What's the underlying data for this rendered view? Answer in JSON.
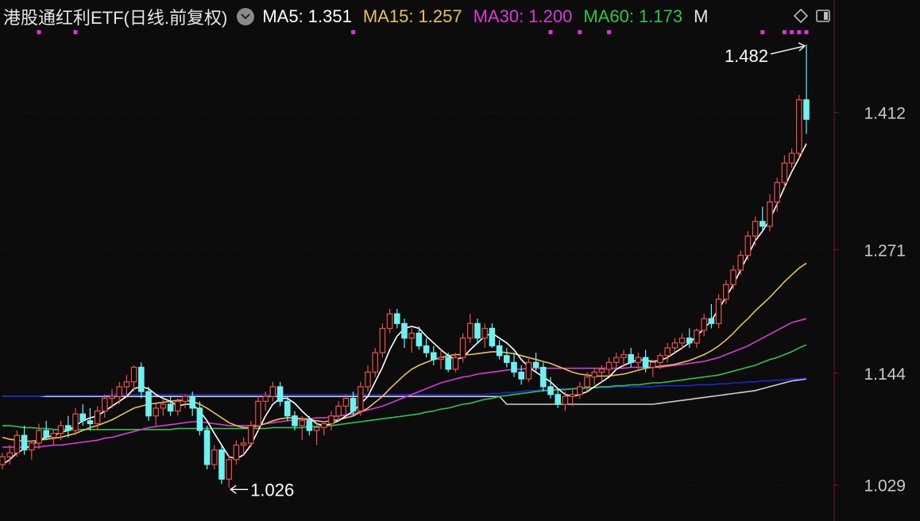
{
  "header": {
    "title": "港股通红利ETF(日线.前复权)",
    "ma_labels": [
      {
        "label": "MA5: 1.351",
        "color": "#ffffff"
      },
      {
        "label": "MA15: 1.257",
        "color": "#e8c15a"
      },
      {
        "label": "MA30: 1.200",
        "color": "#d83ad8"
      },
      {
        "label": "MA60: 1.173",
        "color": "#2ec44a"
      },
      {
        "label": "M",
        "color": "#e6e6e6"
      }
    ]
  },
  "colors": {
    "up": "#e8504a",
    "down": "#6ef1f1",
    "grid": "#4a1010",
    "bg": "#0c0c0c",
    "axis": "#7a1a1a",
    "ma120": "#1a26d8",
    "ma250": "#cfcfcf"
  },
  "chart_data": {
    "type": "candlestick",
    "y_ticks": [
      "1.412",
      "1.271",
      "1.144",
      "1.029"
    ],
    "annotations": {
      "high": "1.482",
      "low": "1.026"
    },
    "ohlc": [
      [
        1.05,
        1.062,
        1.045,
        1.058
      ],
      [
        1.058,
        1.07,
        1.05,
        1.062
      ],
      [
        1.062,
        1.085,
        1.058,
        1.08
      ],
      [
        1.08,
        1.09,
        1.06,
        1.065
      ],
      [
        1.065,
        1.075,
        1.055,
        1.072
      ],
      [
        1.072,
        1.092,
        1.066,
        1.085
      ],
      [
        1.085,
        1.095,
        1.075,
        1.078
      ],
      [
        1.078,
        1.085,
        1.07,
        1.082
      ],
      [
        1.082,
        1.095,
        1.075,
        1.09
      ],
      [
        1.09,
        1.1,
        1.078,
        1.085
      ],
      [
        1.085,
        1.108,
        1.08,
        1.102
      ],
      [
        1.102,
        1.112,
        1.09,
        1.095
      ],
      [
        1.095,
        1.108,
        1.085,
        1.092
      ],
      [
        1.092,
        1.11,
        1.085,
        1.105
      ],
      [
        1.105,
        1.122,
        1.098,
        1.118
      ],
      [
        1.118,
        1.128,
        1.108,
        1.12
      ],
      [
        1.12,
        1.135,
        1.112,
        1.13
      ],
      [
        1.13,
        1.142,
        1.12,
        1.135
      ],
      [
        1.135,
        1.152,
        1.125,
        1.15
      ],
      [
        1.15,
        1.155,
        1.118,
        1.125
      ],
      [
        1.125,
        1.13,
        1.095,
        1.1
      ],
      [
        1.1,
        1.112,
        1.09,
        1.108
      ],
      [
        1.108,
        1.118,
        1.1,
        1.112
      ],
      [
        1.112,
        1.12,
        1.1,
        1.105
      ],
      [
        1.105,
        1.118,
        1.1,
        1.115
      ],
      [
        1.115,
        1.122,
        1.108,
        1.12
      ],
      [
        1.12,
        1.125,
        1.1,
        1.108
      ],
      [
        1.108,
        1.115,
        1.08,
        1.085
      ],
      [
        1.085,
        1.09,
        1.045,
        1.05
      ],
      [
        1.05,
        1.07,
        1.045,
        1.065
      ],
      [
        1.065,
        1.07,
        1.03,
        1.035
      ],
      [
        1.035,
        1.06,
        1.026,
        1.055
      ],
      [
        1.055,
        1.075,
        1.05,
        1.07
      ],
      [
        1.07,
        1.078,
        1.06,
        1.072
      ],
      [
        1.072,
        1.095,
        1.068,
        1.09
      ],
      [
        1.09,
        1.12,
        1.085,
        1.115
      ],
      [
        1.115,
        1.125,
        1.105,
        1.12
      ],
      [
        1.12,
        1.135,
        1.115,
        1.13
      ],
      [
        1.13,
        1.135,
        1.11,
        1.115
      ],
      [
        1.115,
        1.12,
        1.095,
        1.1
      ],
      [
        1.1,
        1.105,
        1.085,
        1.09
      ],
      [
        1.09,
        1.1,
        1.075,
        1.095
      ],
      [
        1.095,
        1.1,
        1.08,
        1.085
      ],
      [
        1.085,
        1.092,
        1.07,
        1.088
      ],
      [
        1.088,
        1.095,
        1.08,
        1.092
      ],
      [
        1.092,
        1.105,
        1.085,
        1.1
      ],
      [
        1.1,
        1.115,
        1.095,
        1.11
      ],
      [
        1.11,
        1.122,
        1.102,
        1.118
      ],
      [
        1.118,
        1.125,
        1.1,
        1.105
      ],
      [
        1.105,
        1.135,
        1.1,
        1.13
      ],
      [
        1.13,
        1.152,
        1.125,
        1.145
      ],
      [
        1.145,
        1.17,
        1.14,
        1.165
      ],
      [
        1.165,
        1.195,
        1.16,
        1.19
      ],
      [
        1.19,
        1.21,
        1.185,
        1.205
      ],
      [
        1.205,
        1.21,
        1.19,
        1.195
      ],
      [
        1.195,
        1.2,
        1.17,
        1.18
      ],
      [
        1.18,
        1.19,
        1.165,
        1.185
      ],
      [
        1.185,
        1.192,
        1.168,
        1.172
      ],
      [
        1.172,
        1.18,
        1.16,
        1.165
      ],
      [
        1.165,
        1.172,
        1.152,
        1.158
      ],
      [
        1.158,
        1.168,
        1.148,
        1.16
      ],
      [
        1.16,
        1.165,
        1.145,
        1.148
      ],
      [
        1.148,
        1.165,
        1.145,
        1.16
      ],
      [
        1.16,
        1.185,
        1.155,
        1.18
      ],
      [
        1.18,
        1.205,
        1.175,
        1.195
      ],
      [
        1.195,
        1.2,
        1.175,
        1.18
      ],
      [
        1.18,
        1.195,
        1.17,
        1.19
      ],
      [
        1.19,
        1.195,
        1.17,
        1.172
      ],
      [
        1.172,
        1.178,
        1.158,
        1.162
      ],
      [
        1.162,
        1.17,
        1.15,
        1.155
      ],
      [
        1.155,
        1.165,
        1.14,
        1.145
      ],
      [
        1.145,
        1.152,
        1.132,
        1.138
      ],
      [
        1.138,
        1.16,
        1.135,
        1.155
      ],
      [
        1.155,
        1.165,
        1.145,
        1.15
      ],
      [
        1.15,
        1.155,
        1.125,
        1.13
      ],
      [
        1.13,
        1.14,
        1.118,
        1.122
      ],
      [
        1.122,
        1.128,
        1.108,
        1.112
      ],
      [
        1.112,
        1.125,
        1.105,
        1.12
      ],
      [
        1.12,
        1.128,
        1.11,
        1.122
      ],
      [
        1.122,
        1.135,
        1.118,
        1.13
      ],
      [
        1.13,
        1.145,
        1.125,
        1.14
      ],
      [
        1.14,
        1.15,
        1.132,
        1.145
      ],
      [
        1.145,
        1.152,
        1.135,
        1.148
      ],
      [
        1.148,
        1.16,
        1.142,
        1.155
      ],
      [
        1.155,
        1.165,
        1.148,
        1.16
      ],
      [
        1.16,
        1.168,
        1.15,
        1.163
      ],
      [
        1.163,
        1.17,
        1.15,
        1.155
      ],
      [
        1.155,
        1.165,
        1.148,
        1.16
      ],
      [
        1.16,
        1.168,
        1.145,
        1.15
      ],
      [
        1.15,
        1.158,
        1.14,
        1.155
      ],
      [
        1.155,
        1.165,
        1.148,
        1.162
      ],
      [
        1.162,
        1.175,
        1.155,
        1.17
      ],
      [
        1.17,
        1.18,
        1.165,
        1.175
      ],
      [
        1.175,
        1.185,
        1.168,
        1.18
      ],
      [
        1.18,
        1.19,
        1.17,
        1.175
      ],
      [
        1.175,
        1.19,
        1.17,
        1.188
      ],
      [
        1.188,
        1.205,
        1.182,
        1.2
      ],
      [
        1.2,
        1.215,
        1.19,
        1.195
      ],
      [
        1.195,
        1.225,
        1.19,
        1.22
      ],
      [
        1.22,
        1.24,
        1.215,
        1.235
      ],
      [
        1.235,
        1.255,
        1.23,
        1.25
      ],
      [
        1.25,
        1.27,
        1.245,
        1.265
      ],
      [
        1.265,
        1.29,
        1.26,
        1.285
      ],
      [
        1.285,
        1.305,
        1.275,
        1.3
      ],
      [
        1.3,
        1.315,
        1.29,
        1.295
      ],
      [
        1.295,
        1.328,
        1.29,
        1.32
      ],
      [
        1.32,
        1.345,
        1.31,
        1.34
      ],
      [
        1.34,
        1.368,
        1.335,
        1.36
      ],
      [
        1.36,
        1.375,
        1.355,
        1.37
      ],
      [
        1.37,
        1.43,
        1.365,
        1.425
      ],
      [
        1.425,
        1.482,
        1.39,
        1.405
      ]
    ],
    "ma5": [
      1.05,
      1.055,
      1.062,
      1.066,
      1.07,
      1.075,
      1.078,
      1.08,
      1.083,
      1.085,
      1.09,
      1.095,
      1.098,
      1.1,
      1.105,
      1.11,
      1.115,
      1.12,
      1.128,
      1.13,
      1.128,
      1.122,
      1.118,
      1.115,
      1.11,
      1.112,
      1.112,
      1.105,
      1.095,
      1.082,
      1.07,
      1.058,
      1.056,
      1.06,
      1.07,
      1.085,
      1.1,
      1.112,
      1.118,
      1.118,
      1.113,
      1.105,
      1.098,
      1.092,
      1.09,
      1.092,
      1.095,
      1.1,
      1.105,
      1.112,
      1.12,
      1.135,
      1.15,
      1.168,
      1.182,
      1.19,
      1.192,
      1.19,
      1.182,
      1.175,
      1.168,
      1.162,
      1.158,
      1.16,
      1.168,
      1.175,
      1.182,
      1.185,
      1.18,
      1.175,
      1.168,
      1.158,
      1.15,
      1.145,
      1.14,
      1.135,
      1.128,
      1.122,
      1.12,
      1.122,
      1.125,
      1.13,
      1.135,
      1.14,
      1.148,
      1.152,
      1.155,
      1.158,
      1.157,
      1.156,
      1.157,
      1.16,
      1.165,
      1.17,
      1.175,
      1.182,
      1.19,
      1.198,
      1.21,
      1.222,
      1.235,
      1.25,
      1.265,
      1.28,
      1.29,
      1.302,
      1.318,
      1.335,
      1.351,
      1.365,
      1.38
    ],
    "ma15": [
      1.078,
      1.076,
      1.075,
      1.074,
      1.074,
      1.075,
      1.076,
      1.077,
      1.078,
      1.08,
      1.082,
      1.085,
      1.088,
      1.09,
      1.093,
      1.096,
      1.1,
      1.104,
      1.108,
      1.11,
      1.112,
      1.113,
      1.114,
      1.115,
      1.116,
      1.116,
      1.115,
      1.112,
      1.108,
      1.103,
      1.098,
      1.093,
      1.09,
      1.088,
      1.088,
      1.09,
      1.092,
      1.095,
      1.097,
      1.098,
      1.098,
      1.097,
      1.096,
      1.095,
      1.094,
      1.095,
      1.096,
      1.098,
      1.1,
      1.104,
      1.108,
      1.114,
      1.12,
      1.128,
      1.135,
      1.142,
      1.148,
      1.152,
      1.155,
      1.158,
      1.16,
      1.162,
      1.163,
      1.163,
      1.163,
      1.164,
      1.165,
      1.166,
      1.166,
      1.165,
      1.164,
      1.162,
      1.16,
      1.158,
      1.156,
      1.154,
      1.151,
      1.148,
      1.145,
      1.143,
      1.142,
      1.141,
      1.141,
      1.141,
      1.142,
      1.143,
      1.145,
      1.147,
      1.149,
      1.15,
      1.151,
      1.152,
      1.153,
      1.155,
      1.157,
      1.16,
      1.163,
      1.167,
      1.172,
      1.178,
      1.185,
      1.193,
      1.2,
      1.208,
      1.215,
      1.222,
      1.23,
      1.238,
      1.245,
      1.252,
      1.257
    ],
    "ma30": [
      1.068,
      1.068,
      1.068,
      1.068,
      1.068,
      1.068,
      1.069,
      1.07,
      1.07,
      1.071,
      1.072,
      1.073,
      1.074,
      1.075,
      1.077,
      1.078,
      1.08,
      1.082,
      1.084,
      1.086,
      1.088,
      1.089,
      1.09,
      1.091,
      1.092,
      1.093,
      1.094,
      1.094,
      1.093,
      1.092,
      1.091,
      1.09,
      1.09,
      1.09,
      1.09,
      1.091,
      1.092,
      1.093,
      1.094,
      1.095,
      1.096,
      1.097,
      1.097,
      1.098,
      1.098,
      1.099,
      1.1,
      1.101,
      1.102,
      1.104,
      1.106,
      1.108,
      1.11,
      1.113,
      1.116,
      1.119,
      1.122,
      1.125,
      1.128,
      1.131,
      1.134,
      1.136,
      1.138,
      1.14,
      1.141,
      1.143,
      1.144,
      1.145,
      1.146,
      1.147,
      1.148,
      1.148,
      1.149,
      1.149,
      1.149,
      1.149,
      1.149,
      1.149,
      1.149,
      1.149,
      1.149,
      1.149,
      1.149,
      1.149,
      1.149,
      1.149,
      1.15,
      1.15,
      1.15,
      1.15,
      1.15,
      1.151,
      1.152,
      1.153,
      1.154,
      1.155,
      1.156,
      1.158,
      1.16,
      1.163,
      1.166,
      1.169,
      1.172,
      1.176,
      1.18,
      1.184,
      1.188,
      1.192,
      1.196,
      1.198,
      1.2
    ],
    "ma60": [
      1.09,
      1.09,
      1.089,
      1.088,
      1.088,
      1.087,
      1.087,
      1.086,
      1.086,
      1.086,
      1.086,
      1.086,
      1.086,
      1.086,
      1.086,
      1.086,
      1.086,
      1.086,
      1.086,
      1.086,
      1.086,
      1.086,
      1.086,
      1.086,
      1.087,
      1.087,
      1.087,
      1.087,
      1.087,
      1.087,
      1.087,
      1.087,
      1.087,
      1.087,
      1.087,
      1.087,
      1.087,
      1.088,
      1.088,
      1.088,
      1.088,
      1.088,
      1.089,
      1.089,
      1.09,
      1.09,
      1.091,
      1.092,
      1.093,
      1.094,
      1.095,
      1.096,
      1.097,
      1.098,
      1.099,
      1.1,
      1.101,
      1.102,
      1.104,
      1.105,
      1.107,
      1.108,
      1.11,
      1.112,
      1.113,
      1.115,
      1.117,
      1.118,
      1.12,
      1.121,
      1.122,
      1.123,
      1.124,
      1.125,
      1.126,
      1.126,
      1.127,
      1.127,
      1.128,
      1.128,
      1.129,
      1.129,
      1.13,
      1.13,
      1.131,
      1.131,
      1.132,
      1.132,
      1.133,
      1.134,
      1.134,
      1.135,
      1.136,
      1.137,
      1.138,
      1.139,
      1.14,
      1.141,
      1.142,
      1.144,
      1.146,
      1.148,
      1.15,
      1.152,
      1.155,
      1.158,
      1.16,
      1.163,
      1.166,
      1.17,
      1.173
    ],
    "ma120": [
      1.12,
      1.12,
      1.12,
      1.12,
      1.12,
      1.12,
      1.121,
      1.121,
      1.121,
      1.121,
      1.121,
      1.121,
      1.121,
      1.121,
      1.121,
      1.122,
      1.122,
      1.122,
      1.122,
      1.122,
      1.122,
      1.122,
      1.122,
      1.122,
      1.122,
      1.122,
      1.122,
      1.122,
      1.122,
      1.122,
      1.122,
      1.122,
      1.122,
      1.122,
      1.122,
      1.122,
      1.122,
      1.122,
      1.122,
      1.122,
      1.122,
      1.122,
      1.122,
      1.122,
      1.122,
      1.122,
      1.122,
      1.122,
      1.122,
      1.122,
      1.122,
      1.122,
      1.122,
      1.122,
      1.122,
      1.122,
      1.122,
      1.122,
      1.122,
      1.122,
      1.122,
      1.122,
      1.122,
      1.122,
      1.122,
      1.122,
      1.122,
      1.123,
      1.123,
      1.124,
      1.124,
      1.125,
      1.126,
      1.126,
      1.127,
      1.127,
      1.128,
      1.128,
      1.128,
      1.129,
      1.129,
      1.129,
      1.129,
      1.129,
      1.13,
      1.13,
      1.13,
      1.13,
      1.13,
      1.13,
      1.131,
      1.131,
      1.131,
      1.131,
      1.131,
      1.132,
      1.132,
      1.132,
      1.133,
      1.133,
      1.134,
      1.134,
      1.135,
      1.135,
      1.136,
      1.136,
      1.137,
      1.137,
      1.138,
      1.138,
      1.139
    ],
    "ma250": [
      1.12,
      1.12,
      1.12,
      1.12,
      1.12,
      1.12,
      1.12,
      1.12,
      1.12,
      1.12,
      1.12,
      1.12,
      1.12,
      1.12,
      1.12,
      1.12,
      1.12,
      1.12,
      1.12,
      1.12,
      1.12,
      1.12,
      1.12,
      1.12,
      1.12,
      1.12,
      1.12,
      1.12,
      1.12,
      1.12,
      1.12,
      1.12,
      1.12,
      1.12,
      1.12,
      1.12,
      1.12,
      1.12,
      1.12,
      1.12,
      1.12,
      1.12,
      1.12,
      1.12,
      1.12,
      1.12,
      1.12,
      1.12,
      1.12,
      1.12,
      1.12,
      1.12,
      1.12,
      1.12,
      1.12,
      1.12,
      1.12,
      1.12,
      1.12,
      1.12,
      1.12,
      1.12,
      1.12,
      1.12,
      1.12,
      1.12,
      1.12,
      1.12,
      1.12,
      1.112,
      1.112,
      1.112,
      1.112,
      1.112,
      1.112,
      1.112,
      1.112,
      1.112,
      1.112,
      1.112,
      1.112,
      1.112,
      1.112,
      1.112,
      1.112,
      1.112,
      1.112,
      1.112,
      1.112,
      1.112,
      1.113,
      1.114,
      1.115,
      1.116,
      1.117,
      1.118,
      1.119,
      1.12,
      1.121,
      1.122,
      1.123,
      1.124,
      1.125,
      1.126,
      1.128,
      1.13,
      1.132,
      1.134,
      1.136,
      1.137,
      1.138
    ]
  }
}
